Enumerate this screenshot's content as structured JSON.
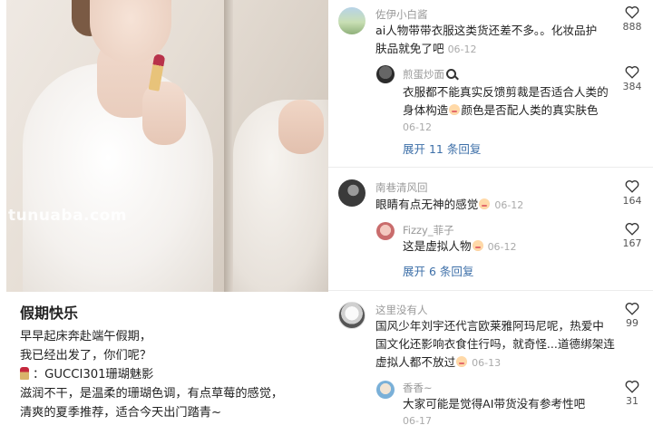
{
  "post": {
    "watermark": "tunuaba.com",
    "title": "假期快乐",
    "lines": [
      "早早起床奔赴端午假期，",
      "我已经出发了，你们呢？",
      "：GUCCI301珊瑚魅影",
      "滋润不干，是温柔的珊瑚色调，有点草莓的感觉，",
      "清爽的夏季推荐，适合今天出门踏青~"
    ]
  },
  "comments": {
    "c1": {
      "user": "佐伊小白酱",
      "text": [
        "ai人物带带衣服这类货还差不多。。化妆品护",
        "肤品就免了吧"
      ],
      "date": "06-12",
      "likes": "888",
      "reply": {
        "user": "煎蛋炒面",
        "text": [
          "衣服都不能真实反馈剪裁是否适合人类的",
          "身体构造",
          "颜色是否配人类的真实肤色"
        ],
        "date": "06-12",
        "likes": "384"
      },
      "expand": "展开 11 条回复"
    },
    "c2": {
      "user": "南巷清风回",
      "text": "眼睛有点无神的感觉",
      "date": "06-12",
      "likes": "164",
      "reply": {
        "user": "Fizzy_菲子",
        "text": "这是虚拟人物",
        "date": "06-12",
        "likes": "167"
      },
      "expand": "展开 6 条回复"
    },
    "c3": {
      "user": "这里没有人",
      "text": [
        "国风少年刘宇还代言欧莱雅阿玛尼呢，热爱中",
        "国文化还影响衣食住行吗，就奇怪...道德绑架连",
        "虚拟人都不放过"
      ],
      "date": "06-13",
      "likes": "99",
      "reply": {
        "user": "香香~",
        "text": "大家可能是觉得AI带货没有参考性吧",
        "date": "06-17",
        "likes": "31"
      }
    }
  }
}
